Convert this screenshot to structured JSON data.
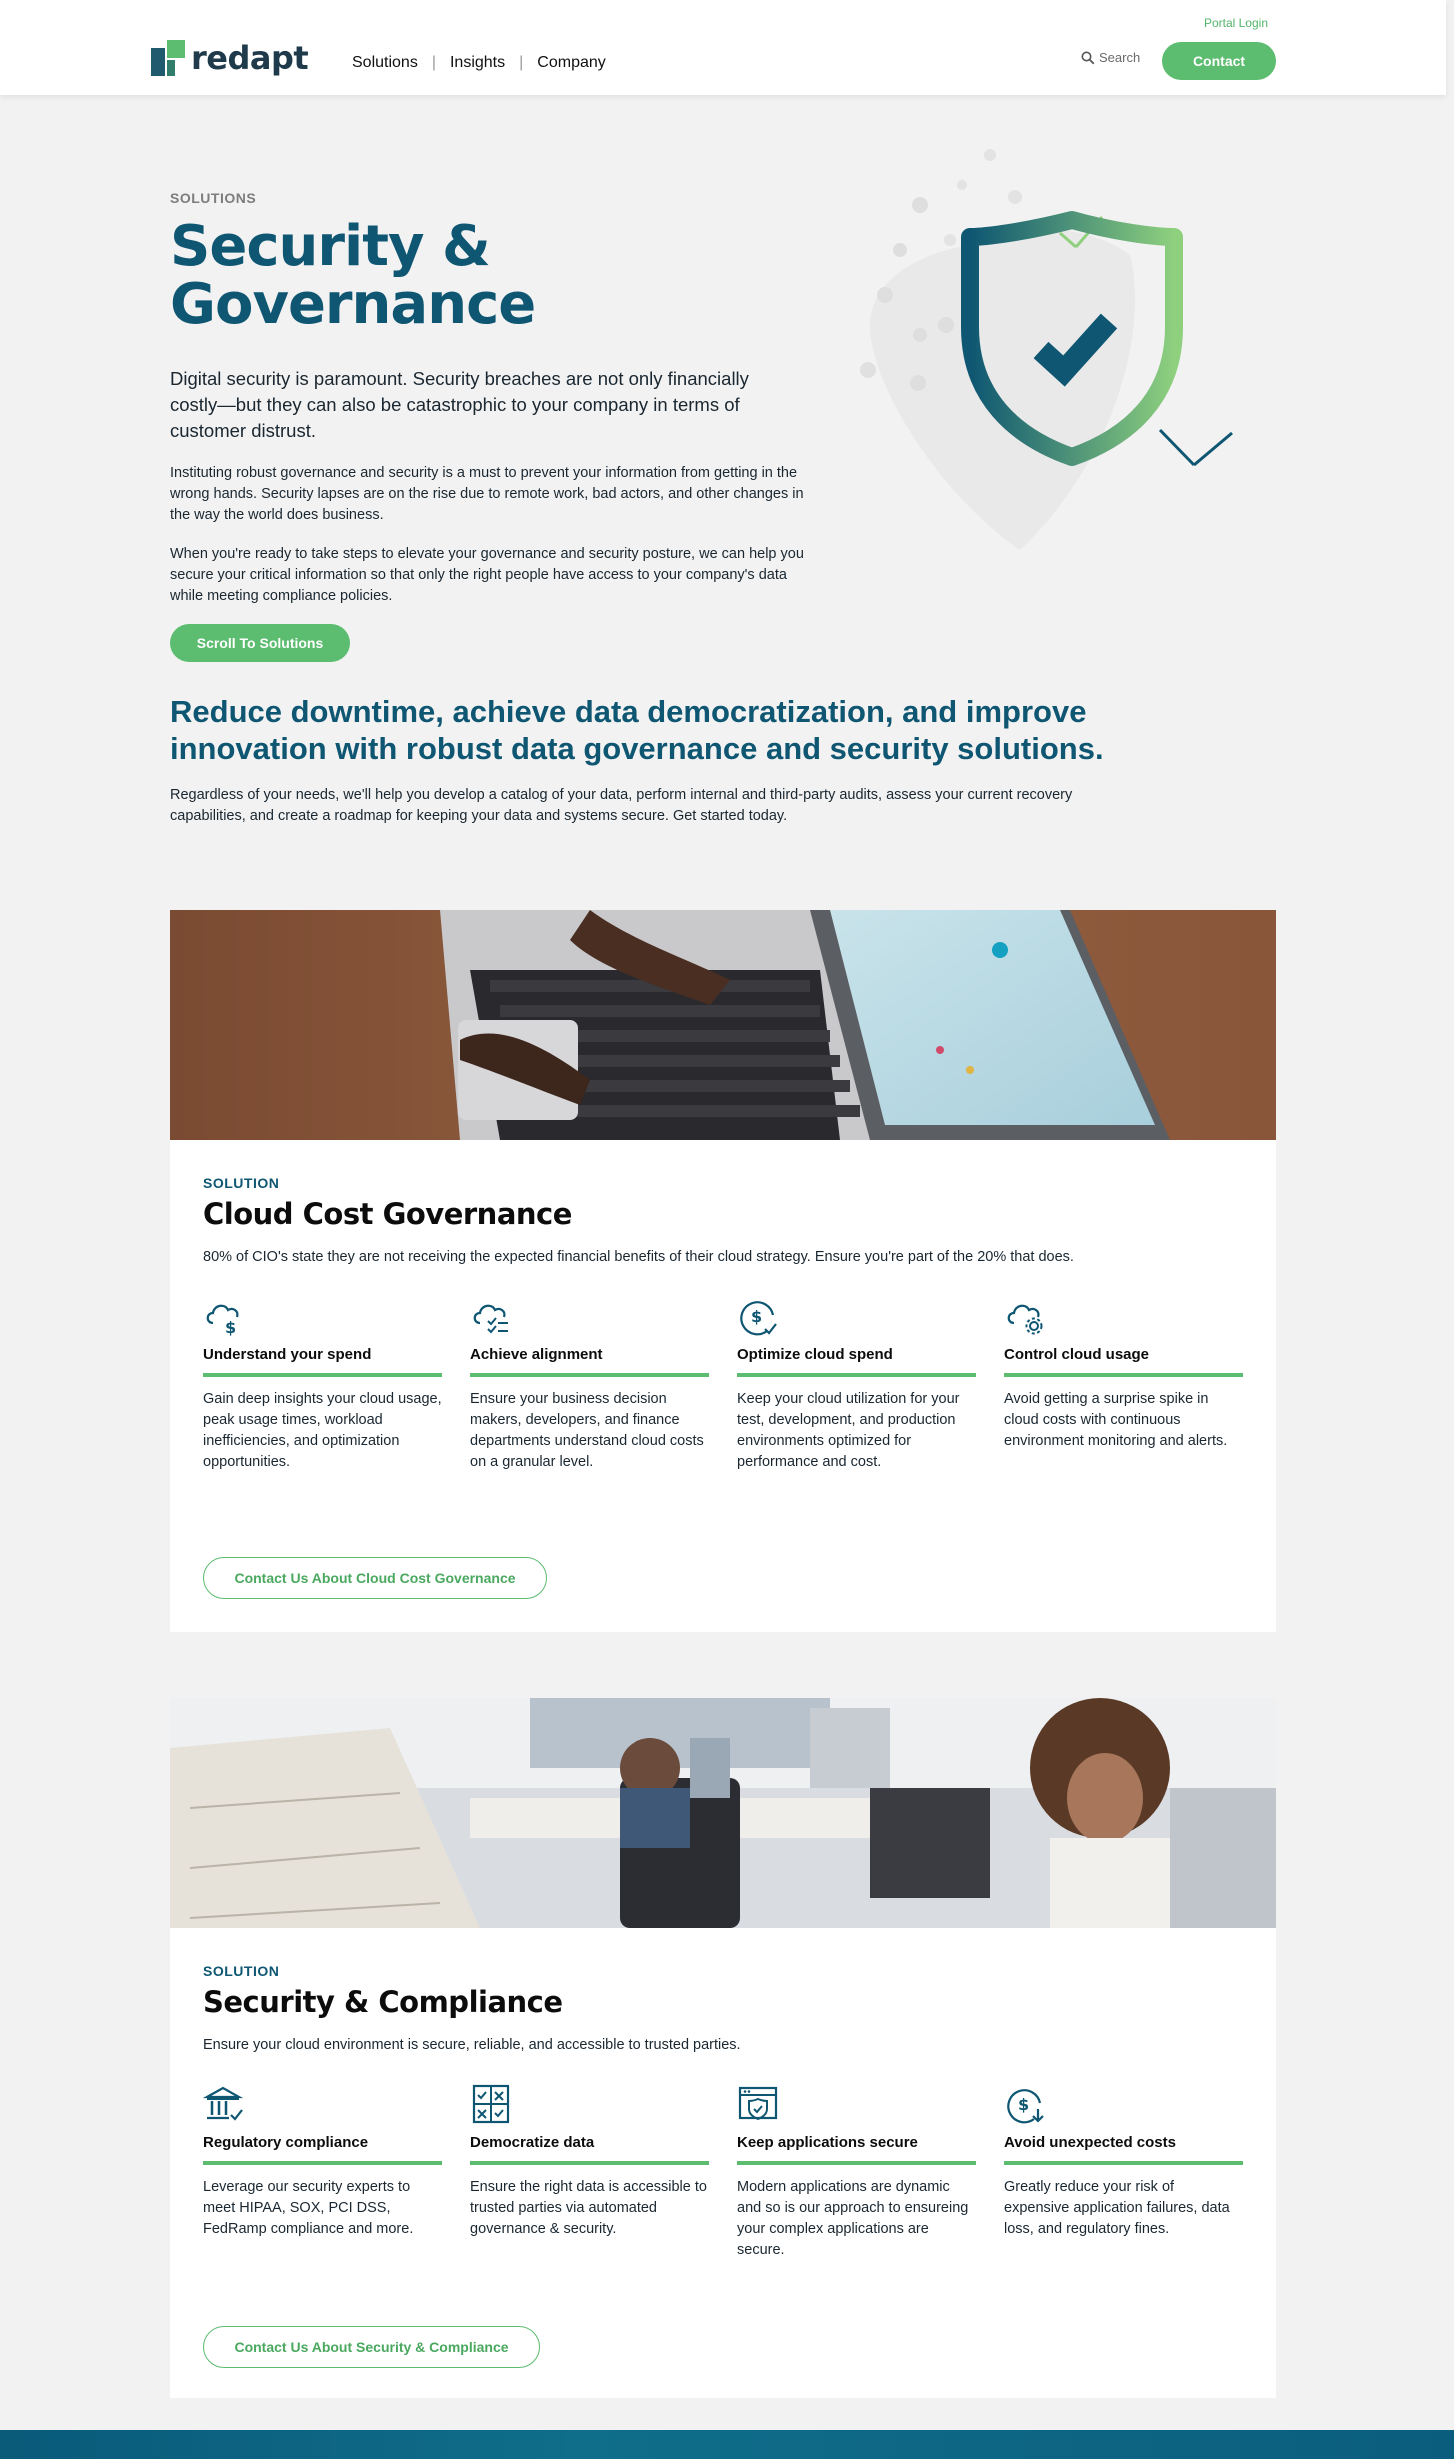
{
  "header": {
    "logo_text": "redapt",
    "nav": [
      {
        "label": "Solutions"
      },
      {
        "label": "Insights"
      },
      {
        "label": "Company"
      }
    ],
    "portal_login": "Portal Login",
    "search_label": "Search",
    "contact_label": "Contact"
  },
  "hero": {
    "eyebrow": "SOLUTIONS",
    "title": "Security & Governance",
    "lead": "Digital security is paramount. Security breaches are not only financially costly—but they can also be catastrophic to your company in terms of customer distrust.",
    "p1": "Instituting robust governance and security is a must to prevent your information from getting in the wrong hands. Security lapses are on the rise due to remote work, bad actors, and other changes in the way the world does business.",
    "p2": "When you're ready to take steps to elevate your governance and security posture, we can help you secure your critical information so that only the right people have access to your company's data while meeting compliance policies.",
    "scroll_button": "Scroll To Solutions"
  },
  "intro": {
    "tagline": "Reduce downtime, achieve data democratization, and improve innovation with robust data governance and security solutions.",
    "description": "Regardless of your needs, we'll help you develop a catalog of your data, perform internal and third-party audits, assess your current recovery capabilities, and create a roadmap for keeping your data and systems secure. Get started today."
  },
  "solutions": [
    {
      "label": "SOLUTION",
      "title": "Cloud Cost Governance",
      "description": "80% of CIO's state they are not receiving the expected financial benefits of their cloud strategy. Ensure you're part of the 20% that does.",
      "features": [
        {
          "icon": "cloud-dollar-icon",
          "title": "Understand your spend",
          "text": "Gain deep insights your cloud usage, peak usage times, workload inefficiencies, and optimization opportunities."
        },
        {
          "icon": "cloud-checklist-icon",
          "title": "Achieve alignment",
          "text": "Ensure your business decision makers, developers, and finance departments understand cloud costs on a granular level."
        },
        {
          "icon": "dollar-check-icon",
          "title": "Optimize cloud spend",
          "text": "Keep your cloud utilization for your test, development, and production environments optimized for performance and cost."
        },
        {
          "icon": "cloud-gear-icon",
          "title": "Control cloud usage",
          "text": "Avoid getting a surprise spike in cloud costs with continuous environment monitoring and alerts."
        }
      ],
      "cta": "Contact Us About Cloud Cost Governance"
    },
    {
      "label": "SOLUTION",
      "title": "Security & Compliance",
      "description": "Ensure your cloud environment is secure, reliable, and accessible to trusted parties.",
      "features": [
        {
          "icon": "bank-check-icon",
          "title": "Regulatory compliance",
          "text": "Leverage our security experts to meet HIPAA, SOX, PCI DSS, FedRamp compliance and more."
        },
        {
          "icon": "grid-checklist-icon",
          "title": "Democratize data",
          "text": "Ensure the right data is accessible to trusted parties via automated governance & security."
        },
        {
          "icon": "browser-shield-icon",
          "title": "Keep applications secure",
          "text": "Modern applications are dynamic and so is our approach to ensureing your complex applications are secure."
        },
        {
          "icon": "dollar-down-icon",
          "title": "Avoid unexpected costs",
          "text": "Greatly reduce your risk of expensive application failures, data loss, and regulatory fines."
        }
      ],
      "cta": "Contact Us About Security & Compliance"
    }
  ],
  "colors": {
    "brand_blue": "#0e5672",
    "brand_green": "#5cbc6f",
    "page_bg": "#f2f2f2"
  }
}
